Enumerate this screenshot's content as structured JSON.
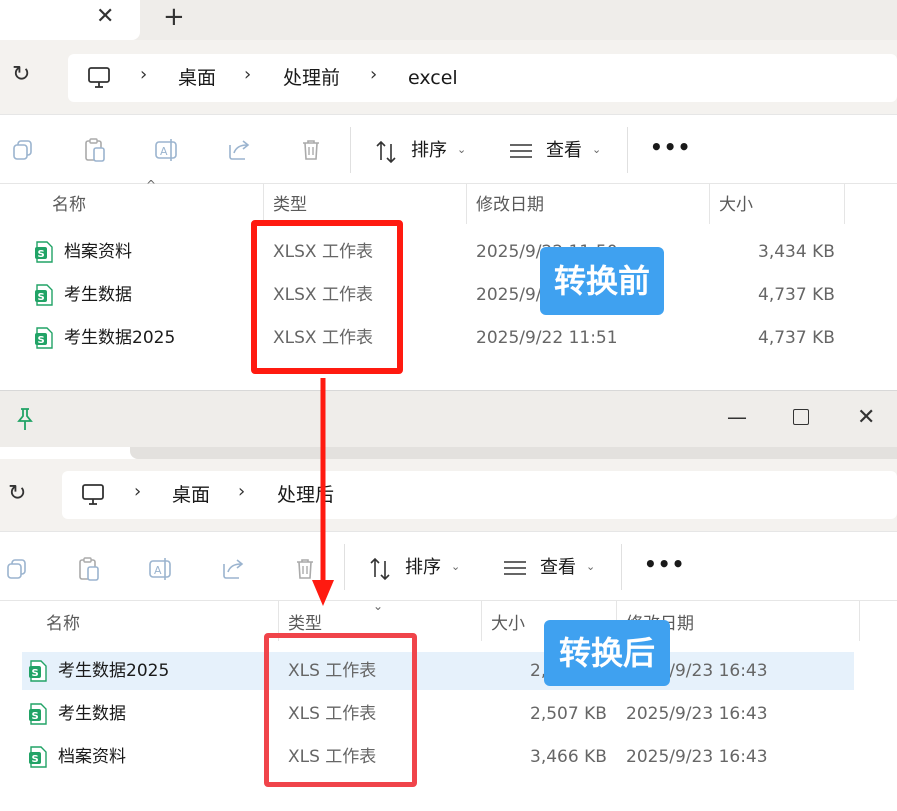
{
  "top_window": {
    "breadcrumb": [
      "桌面",
      "处理前",
      "excel"
    ],
    "toolbar": {
      "sort_label": "排序",
      "view_label": "查看",
      "more_label": "•••"
    },
    "columns": [
      "名称",
      "类型",
      "修改日期",
      "大小"
    ],
    "files": [
      {
        "name": "档案资料",
        "type": "XLSX 工作表",
        "date": "2025/9/22 11:50",
        "size": "3,434 KB"
      },
      {
        "name": "考生数据",
        "type": "XLSX 工作表",
        "date": "2025/9/22 11:50",
        "size": "4,737 KB"
      },
      {
        "name": "考生数据2025",
        "type": "XLSX 工作表",
        "date": "2025/9/22 11:51",
        "size": "4,737 KB"
      }
    ]
  },
  "bottom_window": {
    "breadcrumb": [
      "桌面",
      "处理后"
    ],
    "toolbar": {
      "sort_label": "排序",
      "view_label": "查看",
      "more_label": "•••"
    },
    "columns": [
      "名称",
      "类型",
      "大小",
      "修改日期"
    ],
    "files": [
      {
        "name": "考生数据2025",
        "type": "XLS 工作表",
        "size": "2,507 KB",
        "date": "2025/9/23 16:43"
      },
      {
        "name": "考生数据",
        "type": "XLS 工作表",
        "size": "2,507 KB",
        "date": "2025/9/23 16:43"
      },
      {
        "name": "档案资料",
        "type": "XLS 工作表",
        "size": "3,466 KB",
        "date": "2025/9/23 16:43"
      }
    ]
  },
  "annotations": {
    "before_label": "转换前",
    "after_label": "转换后"
  },
  "colors": {
    "highlight_red": "#ff1a10",
    "badge_blue": "#3fa1f0",
    "excel_green": "#21a366",
    "selected_row": "#e6f1fb"
  },
  "icons": [
    "close-icon",
    "plus-icon",
    "refresh-icon",
    "computer-icon",
    "copy-icon",
    "paste-icon",
    "rename-icon",
    "share-icon",
    "delete-icon",
    "sort-icon",
    "view-icon",
    "pin-icon",
    "minimize-icon",
    "maximize-icon",
    "excel-file-icon"
  ]
}
